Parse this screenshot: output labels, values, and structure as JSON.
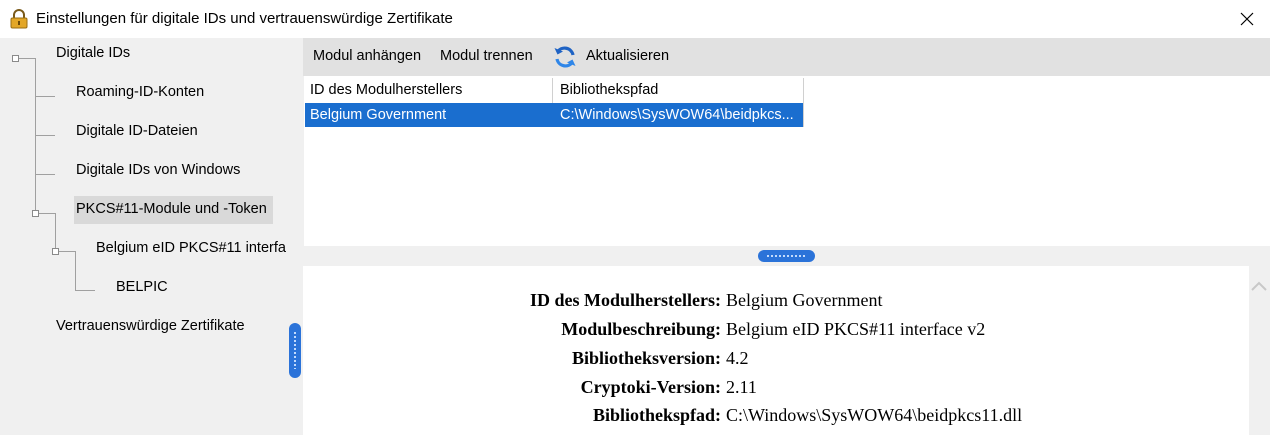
{
  "window": {
    "title": "Einstellungen für digitale IDs und vertrauenswürdige Zertifikate"
  },
  "tree": {
    "items": [
      {
        "label": "Digitale IDs"
      },
      {
        "label": "Roaming-ID-Konten"
      },
      {
        "label": "Digitale ID-Dateien"
      },
      {
        "label": "Digitale IDs von Windows"
      },
      {
        "label": "PKCS#11-Module und -Token"
      },
      {
        "label": "Belgium eID PKCS#11 interfa"
      },
      {
        "label": "BELPIC"
      },
      {
        "label": "Vertrauenswürdige Zertifikate"
      }
    ]
  },
  "toolbar": {
    "attach_label": "Modul anhängen",
    "detach_label": "Modul trennen",
    "refresh_label": "Aktualisieren"
  },
  "list": {
    "columns": [
      "ID des Modulherstellers",
      "Bibliothekspfad"
    ],
    "rows": [
      {
        "manufacturer": "Belgium Government",
        "path": "C:\\Windows\\SysWOW64\\beidpkcs..."
      }
    ]
  },
  "details": [
    {
      "label": "ID des Modulherstellers:",
      "value": "Belgium Government"
    },
    {
      "label": "Modulbeschreibung:",
      "value": "Belgium eID PKCS#11 interface v2"
    },
    {
      "label": "Bibliotheksversion:",
      "value": "4.2"
    },
    {
      "label": "Cryptoki-Version:",
      "value": "2.11"
    },
    {
      "label": "Bibliothekspfad:",
      "value": "C:\\Windows\\SysWOW64\\beidpkcs11.dll"
    }
  ],
  "colors": {
    "selection": "#1a6ecf",
    "accent": "#2b73d9",
    "panel": "#f0f0f0",
    "toolbar": "#e1e1e1"
  }
}
